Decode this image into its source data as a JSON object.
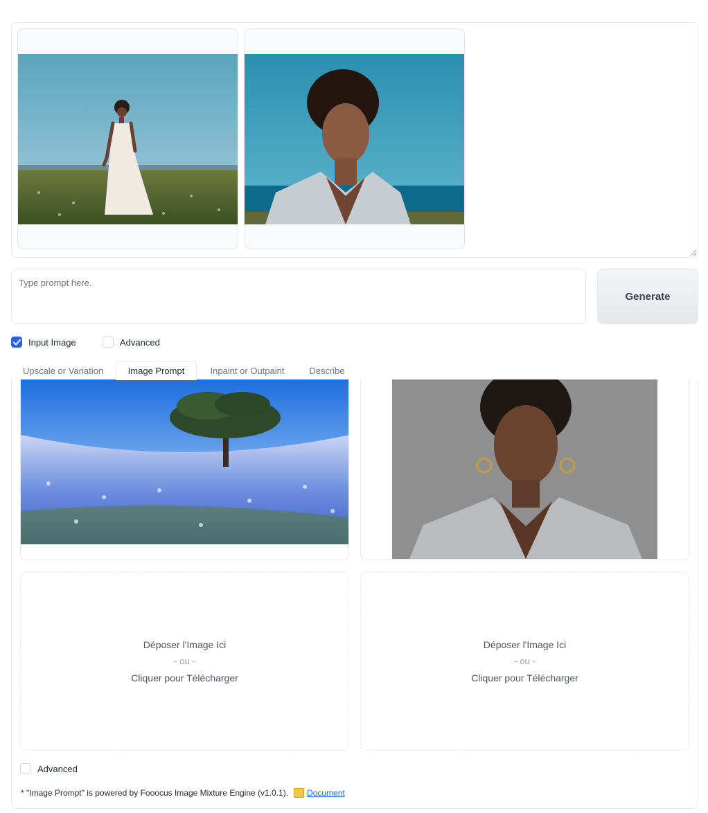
{
  "prompt": {
    "placeholder": "Type prompt here.",
    "value": ""
  },
  "generate_label": "Generate",
  "options": {
    "input_image": {
      "label": "Input Image",
      "checked": true
    },
    "advanced": {
      "label": "Advanced",
      "checked": false
    }
  },
  "tabs": [
    {
      "label": "Upscale or Variation",
      "active": false
    },
    {
      "label": "Image Prompt",
      "active": true
    },
    {
      "label": "Inpaint or Outpaint",
      "active": false
    },
    {
      "label": "Describe",
      "active": false
    }
  ],
  "dropzones": [
    {
      "line1": "Déposer l'Image Ici",
      "line2": "- ou -",
      "line3": "Cliquer pour Télécharger"
    },
    {
      "line1": "Déposer l'Image Ici",
      "line2": "- ou -",
      "line3": "Cliquer pour Télécharger"
    }
  ],
  "image_prompt_advanced": {
    "label": "Advanced",
    "checked": false
  },
  "footer": {
    "text": "* \"Image Prompt\" is powered by Fooocus Image Mixture Engine (v1.0.1).",
    "link_label": "Document",
    "icon": "document-icon"
  },
  "colors": {
    "accent": "#2563eb",
    "border": "#e5e7eb"
  }
}
